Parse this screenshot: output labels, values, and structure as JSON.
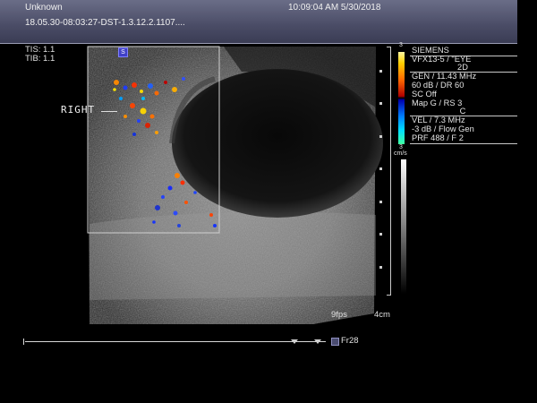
{
  "header": {
    "patient_name": "Unknown",
    "datetime": "10:09:04 AM 5/30/2018",
    "study_id": "18.05.30-08:03:27-DST-1.3.12.2.1107...."
  },
  "indices": {
    "tis": "TIS: 1.1",
    "tib": "TIB: 1.1"
  },
  "image": {
    "side_label": "RIGHT",
    "probe_marker": "S"
  },
  "info_panel": {
    "brand": "SIEMENS",
    "transducer": "VFX13-5 / \"EYE",
    "mode_2d": "2D",
    "gen": "GEN / 11.43 MHz",
    "db_dr": "60 dB / DR 60",
    "sc": "SC Off",
    "map": "Map G / RS 3",
    "mode_c": "C",
    "vel": "VEL / 7.3 MHz",
    "flow": "-3 dB / Flow Gen",
    "prf": "PRF 488 / F 2"
  },
  "color_scale": {
    "top_value": "3",
    "bottom_value": "3",
    "unit": "cm/s"
  },
  "status": {
    "fps": "9fps",
    "depth": "4cm",
    "frame": "Fr28"
  }
}
